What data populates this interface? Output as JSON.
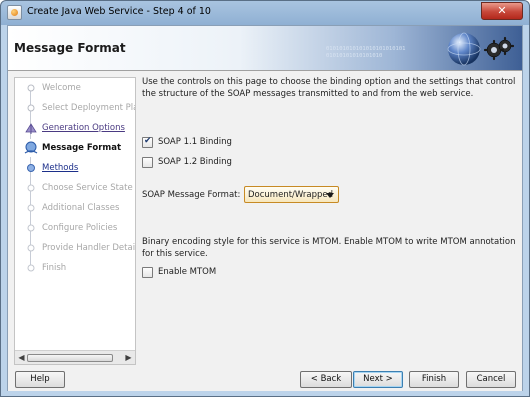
{
  "window": {
    "title": "Create Java Web Service - Step 4 of 10",
    "close_glyph": "✕"
  },
  "header": {
    "title": "Message Format",
    "decoration": "010101010101010101010101\n01010101010101010"
  },
  "steps": [
    {
      "label": "Welcome",
      "state": "done"
    },
    {
      "label": "Select Deployment Platf",
      "state": "done"
    },
    {
      "label": "Generation Options",
      "state": "visited"
    },
    {
      "label": "Message Format",
      "state": "current"
    },
    {
      "label": "Methods",
      "state": "link"
    },
    {
      "label": "Choose Service State",
      "state": "pending"
    },
    {
      "label": "Additional Classes",
      "state": "pending"
    },
    {
      "label": "Configure Policies",
      "state": "pending"
    },
    {
      "label": "Provide Handler Details",
      "state": "pending"
    },
    {
      "label": "Finish",
      "state": "pending"
    }
  ],
  "content": {
    "intro": "Use the controls on this page to choose the binding option and the settings that control the structure of the SOAP messages transmitted to and from the web service.",
    "soap11": {
      "label": "SOAP 1.1 Binding",
      "checked": true
    },
    "soap12": {
      "label": "SOAP 1.2 Binding",
      "checked": false
    },
    "format_label": "SOAP Message Format:",
    "format_value": "Document/Wrapped",
    "mtom_text": "Binary encoding style for this service is MTOM. Enable MTOM to write MTOM annotation for this service.",
    "enable_mtom": {
      "label": "Enable MTOM",
      "checked": false
    }
  },
  "footer": {
    "help": "Help",
    "back": "< Back",
    "next": "Next >",
    "finish": "Finish",
    "cancel": "Cancel"
  },
  "icons": {
    "globe": "globe-icon",
    "gear": "gear-icon",
    "step_marker": "step-marker-icon"
  }
}
